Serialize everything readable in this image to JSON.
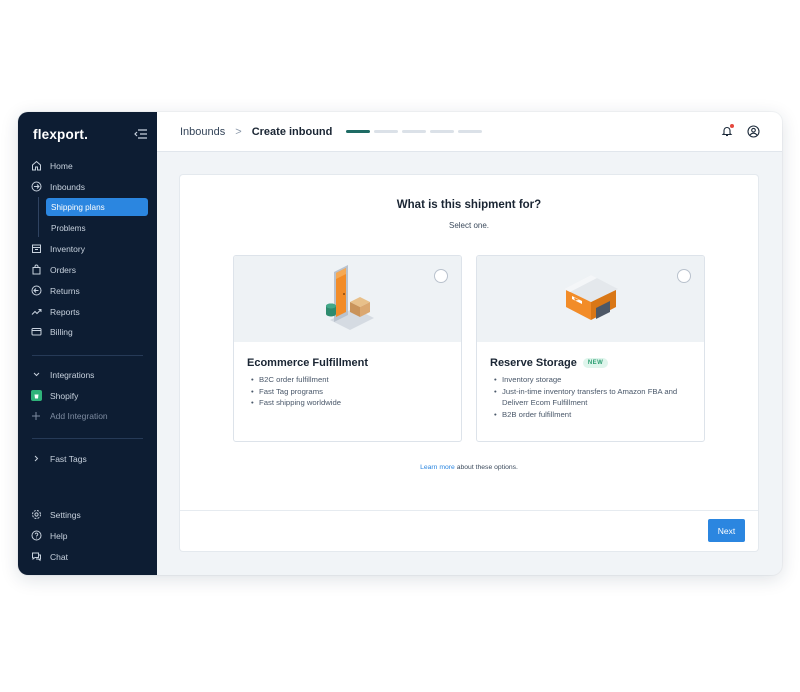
{
  "brand": {
    "logo_text": "flexport."
  },
  "sidebar": {
    "items": [
      {
        "label": "Home",
        "icon": "home-icon"
      },
      {
        "label": "Inbounds",
        "icon": "inbound-icon"
      },
      {
        "label": "Inventory",
        "icon": "inventory-icon"
      },
      {
        "label": "Orders",
        "icon": "bag-icon"
      },
      {
        "label": "Returns",
        "icon": "returns-icon"
      },
      {
        "label": "Reports",
        "icon": "trend-icon"
      },
      {
        "label": "Billing",
        "icon": "card-icon"
      }
    ],
    "sub_items": [
      {
        "label": "Shipping plans",
        "active": true
      },
      {
        "label": "Problems",
        "active": false
      }
    ],
    "integrations": {
      "label": "Integrations",
      "shopify": "Shopify",
      "add": "Add Integration"
    },
    "fast_tags": "Fast Tags",
    "bottom": [
      {
        "label": "Settings",
        "icon": "gear-icon"
      },
      {
        "label": "Help",
        "icon": "help-icon"
      },
      {
        "label": "Chat",
        "icon": "chat-icon"
      }
    ]
  },
  "header": {
    "breadcrumb_parent": "Inbounds",
    "breadcrumb_separator": ">",
    "breadcrumb_current": "Create inbound",
    "progress": {
      "total_steps": 5,
      "completed_steps": 1
    }
  },
  "main": {
    "question": "What is this shipment for?",
    "subtitle": "Select one.",
    "options": [
      {
        "title": "Ecommerce Fulfillment",
        "badge": "",
        "bullets": [
          "B2C order fulfillment",
          "Fast Tag programs",
          "Fast shipping worldwide"
        ]
      },
      {
        "title": "Reserve Storage",
        "badge": "NEW",
        "bullets": [
          "Inventory storage",
          "Just-in-time inventory transfers to Amazon FBA and Deliverr Ecom Fulfillment",
          "B2B order fulfillment"
        ]
      }
    ],
    "learn_more_link": "Learn more",
    "learn_more_suffix": " about these options.",
    "next_label": "Next"
  },
  "colors": {
    "sidebar_bg": "#0d1d33",
    "accent_blue": "#2b86e0",
    "progress_done": "#1e6b64",
    "badge_green": "#2b9e71",
    "illustration_orange": "#f28c28"
  }
}
